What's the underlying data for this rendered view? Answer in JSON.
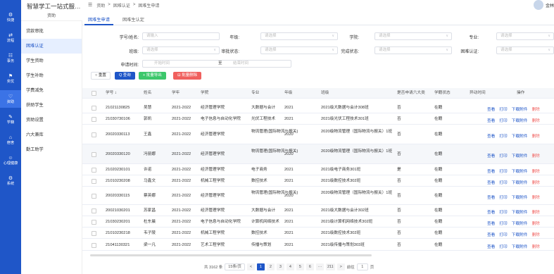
{
  "rail": [
    {
      "icon": "⚙",
      "label": "快捷",
      "icon_name": "shortcut-icon"
    },
    {
      "icon": "⇄",
      "label": "流程",
      "icon_name": "flow-icon"
    },
    {
      "icon": "☷",
      "label": "事务",
      "icon_name": "affairs-icon"
    },
    {
      "icon": "⚑",
      "label": "奖优",
      "icon_name": "award-icon"
    },
    {
      "icon": "♡",
      "label": "资助",
      "icon_name": "aid-icon"
    },
    {
      "icon": "✎",
      "label": "学籍",
      "icon_name": "status-icon"
    },
    {
      "icon": "⌂",
      "label": "宿舍",
      "icon_name": "dorm-icon"
    },
    {
      "icon": "☺",
      "label": "心理健康",
      "icon_name": "psychology-icon"
    },
    {
      "icon": "⚙",
      "label": "系统",
      "icon_name": "system-icon"
    }
  ],
  "brand": {
    "name": "智慧学工一站式服…",
    "sub": "资助"
  },
  "subnav": [
    "贷款审批",
    "困难认证",
    "学生资助",
    "学生补助",
    "学费减免",
    "获助学生",
    "资助设置",
    "六大兼库",
    "勤工助学"
  ],
  "breadcrumb": {
    "menu": "☰",
    "a": "资助",
    "b": "困难认证",
    "c": "困难生申请",
    "sep": ">"
  },
  "user": {
    "name": "金林"
  },
  "tabs": [
    "困难生申请",
    "困难生认定"
  ],
  "filters": {
    "row1": [
      {
        "label": "学号/姓名:",
        "ph": "请输入"
      },
      {
        "label": "年级:",
        "ph": "请选择"
      },
      {
        "label": "学院:",
        "ph": "请选择"
      },
      {
        "label": "专业:",
        "ph": "请选择"
      }
    ],
    "row2": [
      {
        "label": "班级:",
        "ph": "请选择"
      },
      {
        "label": "审批状态:",
        "ph": "请选择"
      },
      {
        "label": "完成状态:",
        "ph": "请选择"
      },
      {
        "label": "困难认证:",
        "ph": "请选择"
      }
    ],
    "time_label": "申请时间:",
    "time_start": "开始时间",
    "time_sep": "至",
    "time_end": "结束时间"
  },
  "buttons": {
    "reset": "○ 重置",
    "search": "Q 查询",
    "export": "+ 批量导出",
    "delete": "⊟ 批量删除"
  },
  "columns": [
    "学号 ↕",
    "姓名",
    "学年",
    "学院",
    "专业",
    "年级",
    "班级",
    "是否申请六大类",
    "学籍状态",
    "异动时间",
    "操作"
  ],
  "rows": [
    {
      "id": "21021130825",
      "name": "吴慧",
      "year": "2021-2022",
      "college": "经济管理学院",
      "major": "大数据与会计",
      "grade": "2021",
      "cls": "2021级大数据与会计308班",
      "six": "否",
      "stat": "在籍"
    },
    {
      "id": "21030730106",
      "name": "郭凯",
      "year": "2021-2022",
      "college": "电子信息与自动化学院",
      "major": "光伏工程技术",
      "grade": "2021",
      "cls": "2021级光伏工程技术301班",
      "six": "否",
      "stat": "在籍"
    },
    {
      "id": "20020330113",
      "name": "王鑫",
      "year": "2021-2022",
      "college": "经济管理学院",
      "major": "物流管理(国际物流与报关)",
      "grade": "2020",
      "cls": "2020级物流管理（国际物流与报关）1班",
      "six": "否",
      "stat": "在籍"
    },
    {
      "id": "20020330120",
      "name": "冯丽娜",
      "year": "2021-2022",
      "college": "经济管理学院",
      "major": "物流管理(国际物流与报关)",
      "grade": "2020",
      "cls": "2020级物流管理（国际物流与报关）1班",
      "six": "否",
      "stat": "在籍"
    },
    {
      "id": "21020230101",
      "name": "许诺",
      "year": "2021-2022",
      "college": "经济管理学院",
      "major": "电子商务",
      "grade": "2021",
      "cls": "2021级电子商务301班",
      "six": "是",
      "stat": "在籍"
    },
    {
      "id": "21010230208",
      "name": "马鑫文",
      "year": "2021-2022",
      "college": "机械工程学院",
      "major": "数控技术",
      "grade": "2021",
      "cls": "2021级数控技术302班",
      "six": "否",
      "stat": "在籍"
    },
    {
      "id": "20020330115",
      "name": "蔡英娜",
      "year": "2021-2022",
      "college": "经济管理学院",
      "major": "物流管理(国际物流与报关)",
      "grade": "2020",
      "cls": "2020级物流管理（国际物流与报关）1班",
      "six": "否",
      "stat": "在籍"
    },
    {
      "id": "20021030201",
      "name": "苏家昌",
      "year": "2021-2022",
      "college": "经济管理学院",
      "major": "大数据与会计",
      "grade": "2021",
      "cls": "2021级大数据与会计302班",
      "six": "否",
      "stat": "在籍"
    },
    {
      "id": "21030230201",
      "name": "杜东晨",
      "year": "2021-2022",
      "college": "电子信息与自动化学院",
      "major": "计算机网络技术",
      "grade": "2021",
      "cls": "2021级计算机网络技术302班",
      "six": "否",
      "stat": "在籍"
    },
    {
      "id": "21010230218",
      "name": "韦子陵",
      "year": "2021-2022",
      "college": "机械工程学院",
      "major": "数控技术",
      "grade": "2021",
      "cls": "2021级数控技术302班",
      "six": "否",
      "stat": "在籍"
    },
    {
      "id": "21041130321",
      "name": "梁一凡",
      "year": "2021-2022",
      "college": "艺术工程学院",
      "major": "传播与策划",
      "grade": "2021",
      "cls": "2021级传播与策划303班",
      "six": "否",
      "stat": "在籍"
    }
  ],
  "actions": {
    "view": "查看",
    "print": "打印",
    "download": "下载附件",
    "del": "删除"
  },
  "pager": {
    "total": "共 3162 条",
    "size": "15条/页",
    "pages": [
      "1",
      "2",
      "3",
      "4",
      "5",
      "6",
      "···",
      "211"
    ],
    "goto": "前往",
    "goto_val": "1",
    "page_unit": "页",
    "prev": "<",
    "next": ">"
  }
}
